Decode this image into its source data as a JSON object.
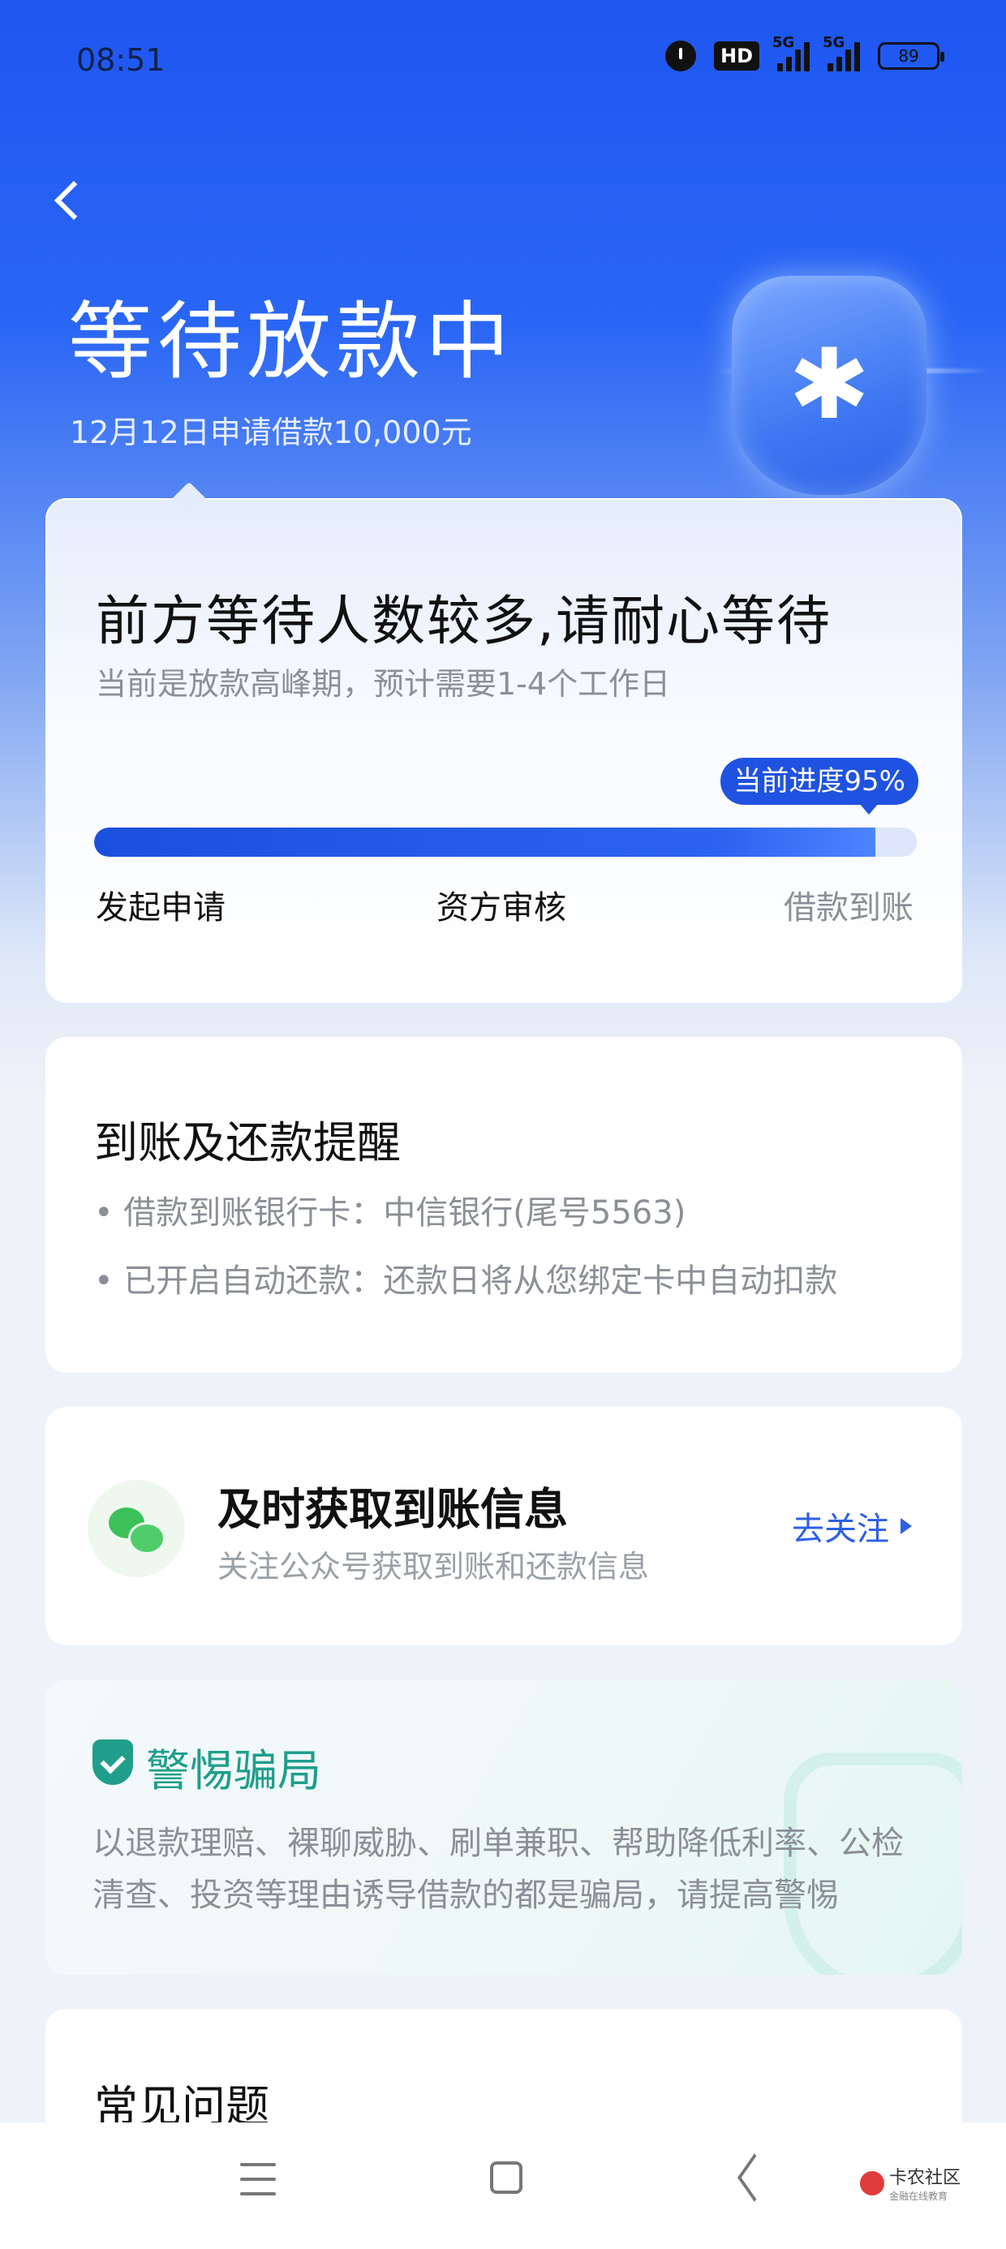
{
  "status_bar": {
    "time": "08:51",
    "hd_label": "HD",
    "network_1": "5G",
    "network_2": "5G",
    "battery": "89"
  },
  "header": {
    "title": "等待放款中",
    "subtitle": "12月12日申请借款10,000元"
  },
  "progress_card": {
    "headline": "前方等待人数较多,请耐心等待",
    "note": "当前是放款高峰期，预计需要1-4个工作日",
    "badge": "当前进度95%",
    "progress": 0.95,
    "steps": [
      "发起申请",
      "资方审核",
      "借款到账"
    ]
  },
  "reminder_card": {
    "title": "到账及还款提醒",
    "lines": [
      "• 借款到账银行卡：中信银行(尾号5563)",
      "• 已开启自动还款：还款日将从您绑定卡中自动扣款"
    ]
  },
  "follow_card": {
    "title": "及时获取到账信息",
    "subtitle": "关注公众号获取到账和还款信息",
    "link": "去关注"
  },
  "fraud_card": {
    "title": "警惕骗局",
    "text": "以退款理赔、裸聊威胁、刷单兼职、帮助降低利率、公检清查、投资等理由诱导借款的都是骗局，请提高警惕"
  },
  "faq_card": {
    "title": "常见问题"
  },
  "watermark": {
    "main": "卡农社区",
    "sub": "金融在线教育"
  },
  "colors": {
    "brand_blue": "#1f52e0",
    "fraud_green": "#1f9e8c",
    "wechat_green": "#3cc15a"
  }
}
